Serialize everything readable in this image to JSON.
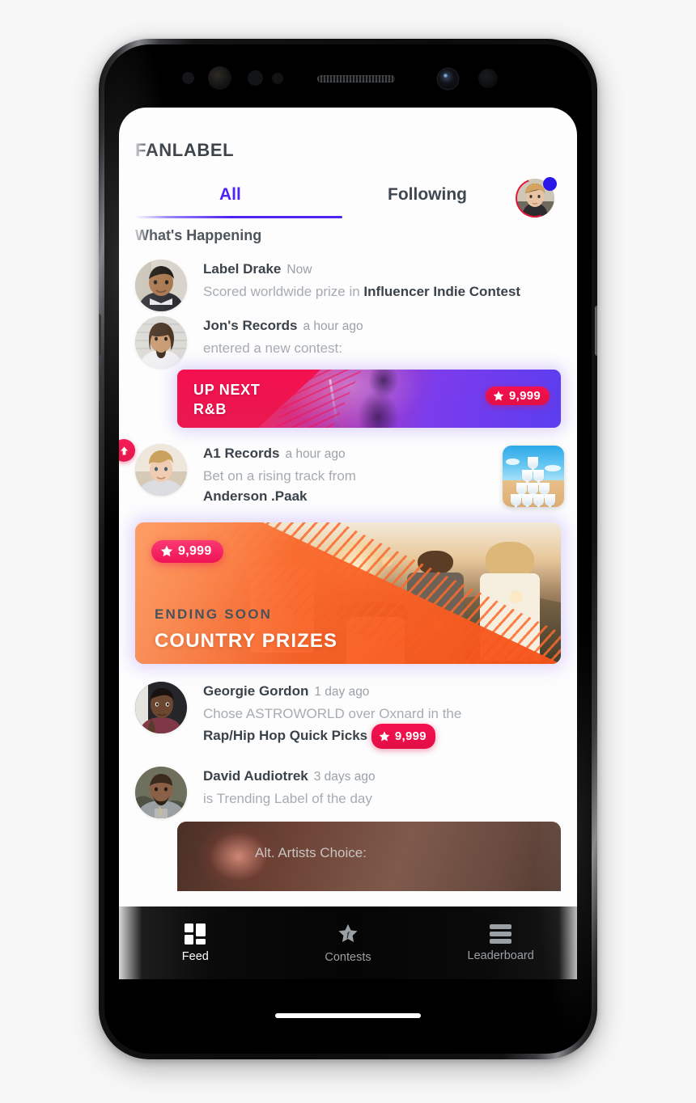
{
  "app": {
    "brand": "FANLABEL"
  },
  "tabs": {
    "all": "All",
    "following": "Following"
  },
  "section": {
    "heading": "What's Happening"
  },
  "feed": [
    {
      "user": "Label Drake",
      "time": "Now",
      "message_plain": "Scored worldwide prize in ",
      "message_bold": "Influencer Indie Contest"
    },
    {
      "user": "Jon's Records",
      "time": "a hour ago",
      "message_plain": "entered a new contest:",
      "card": {
        "line1": "UP NEXT",
        "line2": "R&B",
        "points": "9,999"
      }
    },
    {
      "user": "A1 Records",
      "time": "a hour ago",
      "message_plain": "Bet on a rising track from ",
      "message_bold": "Anderson .Paak",
      "thumb": "album-thumbnail-bubblin",
      "thumb_badge": "up-arrow-icon"
    },
    {
      "user": "Georgie Gordon",
      "time": "1 day ago",
      "message_plain": "Chose ASTROWORLD over Oxnard in the ",
      "message_bold": "Rap/Hip Hop Quick Picks",
      "points": "9,999"
    },
    {
      "user": "David Audiotrek",
      "time": "3 days ago",
      "message_plain": "is Trending Label of the day"
    }
  ],
  "banner": {
    "eyebrow": "ENDING SOON",
    "title": "COUNTRY PRIZES",
    "points": "9,999"
  },
  "partial_card": {
    "title": "Alt. Artists Choice:"
  },
  "nav": [
    {
      "label": "Feed",
      "icon": "grid-icon",
      "active": true
    },
    {
      "label": "Contests",
      "icon": "star-icon",
      "active": false
    },
    {
      "label": "Leaderboard",
      "icon": "hamburger-icon",
      "active": false
    }
  ],
  "colors": {
    "accent_violet": "#4c24f5",
    "accent_pink": "#e20f45",
    "accent_orange": "#fa6a2e",
    "text_dark": "#3a424a",
    "text_muted": "#a6acb2"
  }
}
